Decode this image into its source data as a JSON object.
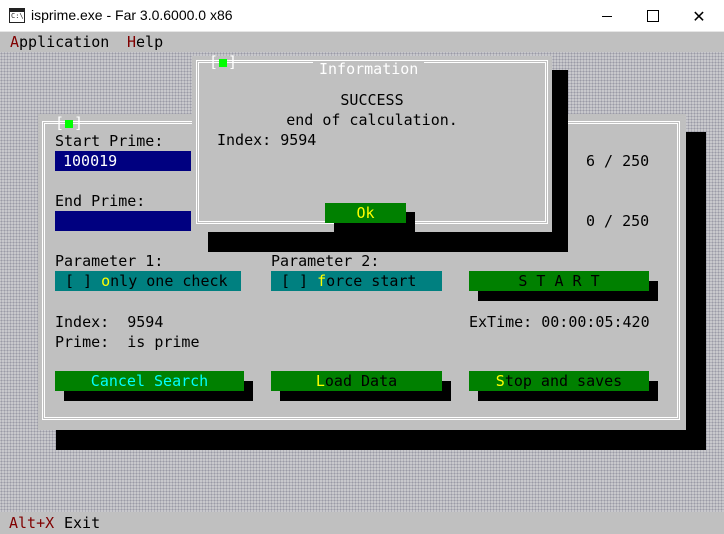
{
  "window": {
    "title": "isprime.exe - Far 3.0.6000.0 x86",
    "close_glyph": "✕"
  },
  "menu": {
    "application_hot": "A",
    "application_rest": "pplication",
    "help_hot": "H",
    "help_rest": "elp"
  },
  "keybar": {
    "hint": "Alt+X",
    "label": "Exit"
  },
  "dialog_close_mark": {
    "left": "[",
    "right": "]"
  },
  "main": {
    "start_prime_label": "Start Prime:",
    "start_prime_value": "100019",
    "start_count": "6 / 250",
    "end_prime_label": "End Prime:",
    "end_prime_value": "",
    "end_count": "0 / 250",
    "parameter1_label": "Parameter 1:",
    "parameter1_box": "[ ] ",
    "parameter1_hot": "o",
    "parameter1_rest": "nly one check",
    "parameter2_label": "Parameter 2:",
    "parameter2_box": "[ ] ",
    "parameter2_hot": "f",
    "parameter2_rest": "orce start",
    "start_button": "S T A R T",
    "index_line": "Index:  9594",
    "prime_line": "Prime:  is prime",
    "extime_line": "ExTime: 00:00:05:420",
    "cancel_button": "Cancel Search",
    "load_hot": "L",
    "load_rest": "oad Data",
    "stop_hot": "S",
    "stop_rest": "top and saves"
  },
  "info": {
    "title": "Information",
    "line1": "SUCCESS",
    "line2": "end of calculation.",
    "index_line": "Index: 9594",
    "ok_button": "Ok"
  },
  "colors": {
    "console_bg": "#c0c0c0",
    "field_bg": "#000080",
    "checkbox_bg": "#008080",
    "button_bg": "#008000",
    "hotkey": "#ffff00",
    "menu_hotkey": "#800000",
    "close_square": "#00ff00"
  }
}
